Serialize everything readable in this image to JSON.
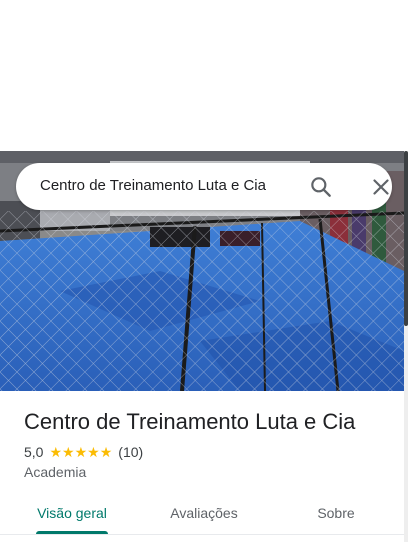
{
  "search": {
    "query": "Centro de Treinamento Luta e Cia"
  },
  "place": {
    "name": "Centro de Treinamento Luta e Cia",
    "rating": "5,0",
    "stars": 5,
    "review_count": "(10)",
    "category": "Academia"
  },
  "tabs": [
    {
      "label": "Visão geral",
      "active": true
    },
    {
      "label": "Avaliações",
      "active": false
    },
    {
      "label": "Sobre",
      "active": false
    }
  ],
  "icons": {
    "search": "search-icon",
    "close": "close-icon",
    "star": "star-icon"
  },
  "colors": {
    "accent": "#00796b",
    "star": "#fbbc04",
    "mat": "#2f6fd0"
  }
}
